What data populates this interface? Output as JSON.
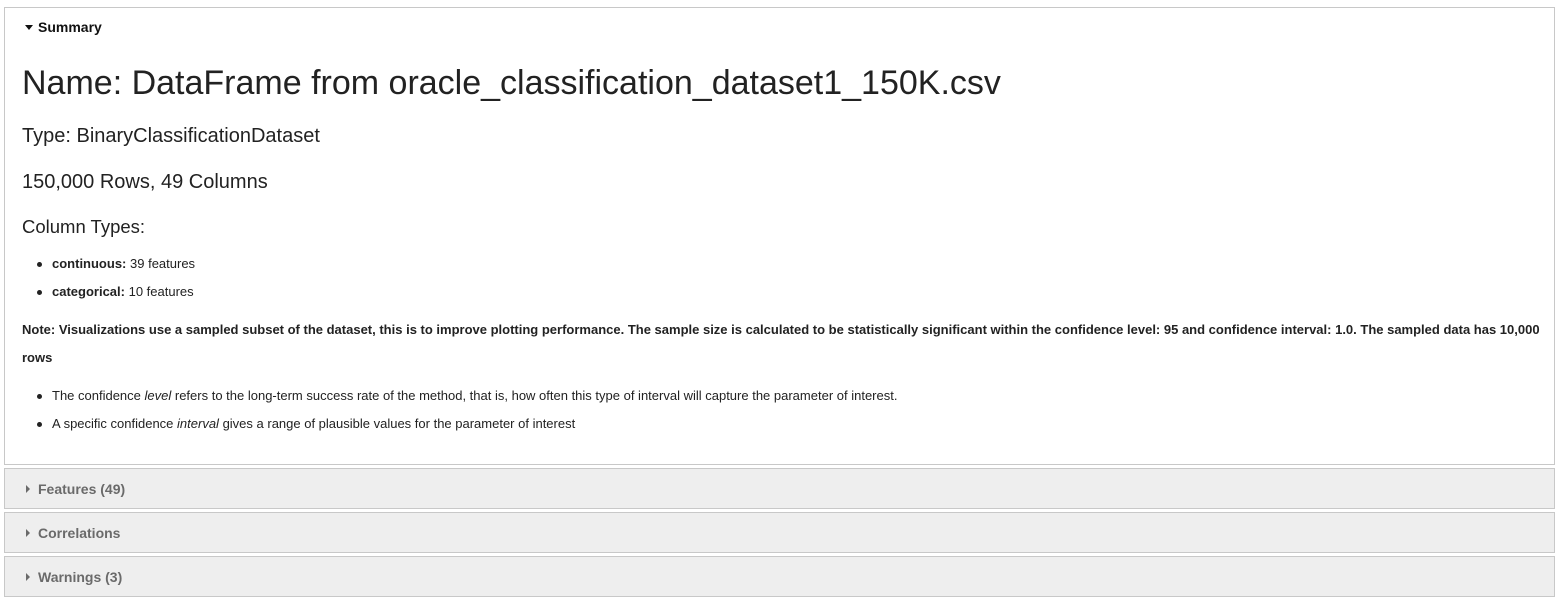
{
  "summary": {
    "header_label": "Summary",
    "name_line": "Name: DataFrame from oracle_classification_dataset1_150K.csv",
    "type_line": "Type: BinaryClassificationDataset",
    "rows_columns_line": "150,000 Rows, 49 Columns",
    "column_types_heading": "Column Types:",
    "column_types": [
      {
        "label": "continuous:",
        "value": "39 features"
      },
      {
        "label": "categorical:",
        "value": "10 features"
      }
    ],
    "note": "Note: Visualizations use a sampled subset of the dataset, this is to improve plotting performance. The sample size is calculated to be statistically significant within the confidence level: 95 and confidence interval: 1.0. The sampled data has 10,000 rows",
    "confidence_notes": [
      {
        "prefix": "The confidence ",
        "emphasis": "level",
        "suffix": " refers to the long-term success rate of the method, that is, how often this type of interval will capture the parameter of interest."
      },
      {
        "prefix": "A specific confidence ",
        "emphasis": "interval",
        "suffix": " gives a range of plausible values for the parameter of interest"
      }
    ]
  },
  "sections": [
    {
      "label": "Features (49)"
    },
    {
      "label": "Correlations"
    },
    {
      "label": "Warnings (3)"
    }
  ],
  "icons": {
    "expanded": "caret-down-icon",
    "collapsed": "caret-right-icon"
  },
  "colors": {
    "collapsed_background": "#eeeeee",
    "border": "#c8c8c8",
    "collapsed_text": "#6a6a6a"
  }
}
